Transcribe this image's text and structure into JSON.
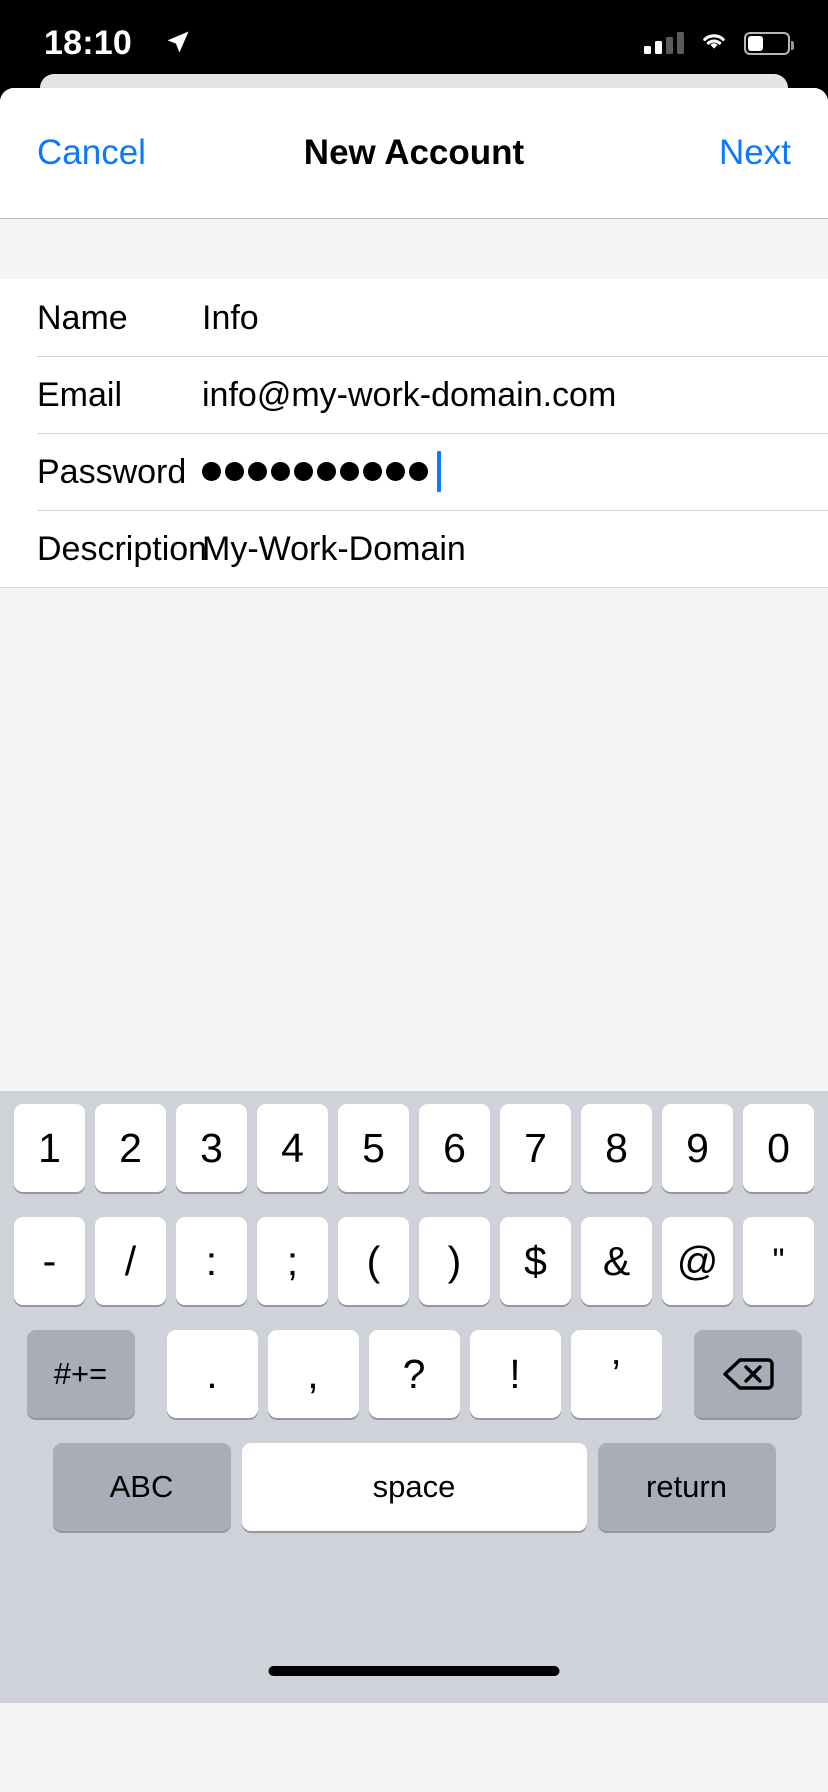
{
  "status_bar": {
    "time": "18:10",
    "location_icon": "location-arrow-icon",
    "cellular_icon": "signal-bars-icon",
    "cellular_bars_filled": 2,
    "cellular_bars_total": 4,
    "wifi_icon": "wifi-icon",
    "battery_icon": "battery-icon",
    "battery_level_percent": 35
  },
  "nav_bar": {
    "cancel_label": "Cancel",
    "title": "New Account",
    "next_label": "Next",
    "accent_color": "#0b79fe"
  },
  "form": {
    "rows": [
      {
        "label": "Name",
        "value": "Info",
        "type": "text"
      },
      {
        "label": "Email",
        "value": "info@my-work-domain.com",
        "type": "email"
      },
      {
        "label": "Password",
        "value": "••••••••••",
        "type": "password",
        "dot_count": 10,
        "focused": true
      },
      {
        "label": "Description",
        "value": "My-Work-Domain",
        "type": "text"
      }
    ]
  },
  "keyboard": {
    "row1": [
      "1",
      "2",
      "3",
      "4",
      "5",
      "6",
      "7",
      "8",
      "9",
      "0"
    ],
    "row2": [
      "-",
      "/",
      ":",
      ";",
      "(",
      ")",
      "$",
      "&",
      "@",
      "\""
    ],
    "row3": {
      "symbols_key": "#+=",
      "punctuation": [
        ".",
        ",",
        "?",
        "!",
        "’"
      ],
      "delete_icon": "backspace-icon"
    },
    "row4": {
      "abc_label": "ABC",
      "space_label": "space",
      "return_label": "return"
    }
  },
  "home_indicator": "home-indicator"
}
